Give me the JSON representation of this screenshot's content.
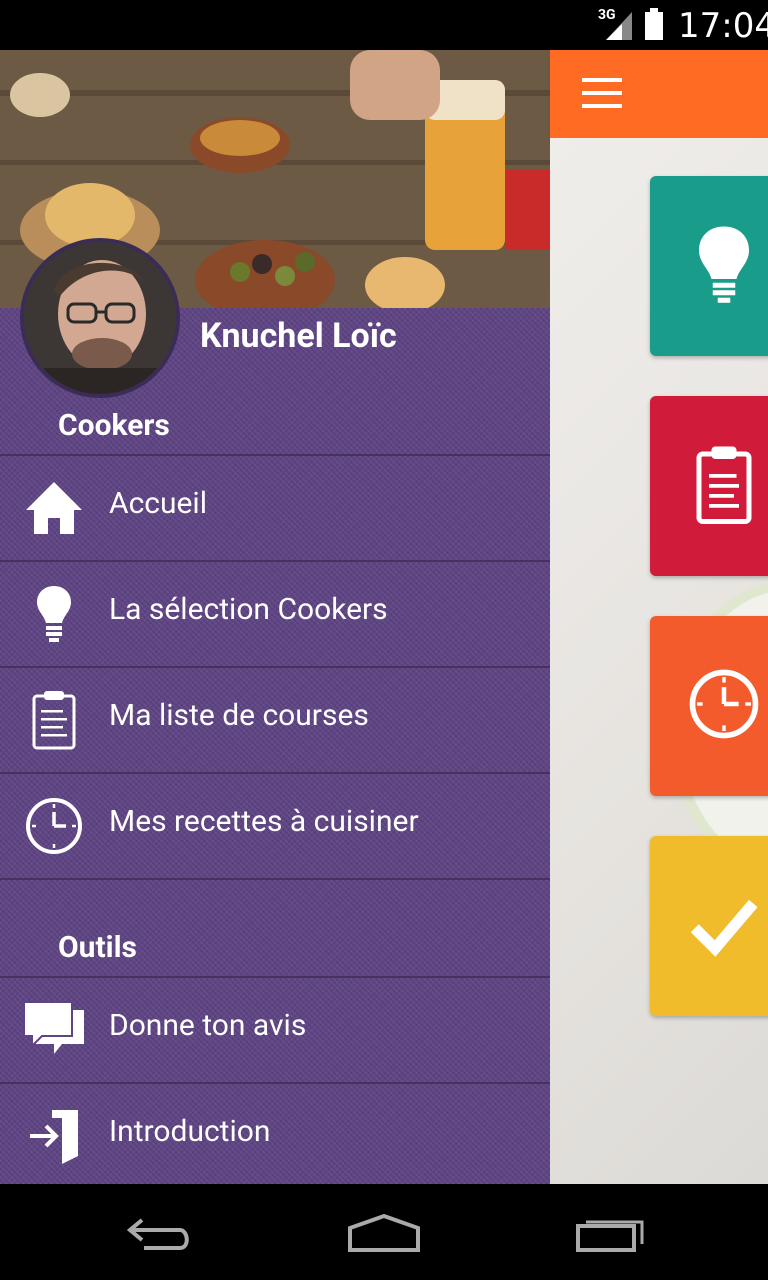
{
  "status_bar": {
    "network": "3G",
    "time": "17:04"
  },
  "drawer": {
    "user_name": "Knuchel Loïc",
    "sections": [
      {
        "title": "Cookers",
        "items": [
          {
            "label": "Accueil",
            "icon": "home-icon"
          },
          {
            "label": "La sélection Cookers",
            "icon": "lightbulb-icon"
          },
          {
            "label": "Ma liste de courses",
            "icon": "clipboard-list-icon"
          },
          {
            "label": "Mes recettes à cuisiner",
            "icon": "clock-icon"
          }
        ]
      },
      {
        "title": "Outils",
        "items": [
          {
            "label": "Donne ton avis",
            "icon": "chat-bubbles-icon"
          },
          {
            "label": "Introduction",
            "icon": "enter-door-icon"
          }
        ]
      }
    ]
  },
  "main": {
    "toolbar_icon": "hamburger-menu-icon",
    "tiles": [
      {
        "icon": "lightbulb-icon",
        "color": "#1a9c8a"
      },
      {
        "icon": "clipboard-list-icon",
        "color": "#d01b3a"
      },
      {
        "icon": "clock-icon",
        "color": "#f45b2c"
      },
      {
        "icon": "checkmark-icon",
        "color": "#f0bc2c"
      }
    ]
  },
  "colors": {
    "toolbar": "#ff6b23",
    "drawer": "#5e4484"
  },
  "nav_bar": {
    "buttons": [
      "back-icon",
      "home-icon",
      "recents-icon"
    ]
  }
}
